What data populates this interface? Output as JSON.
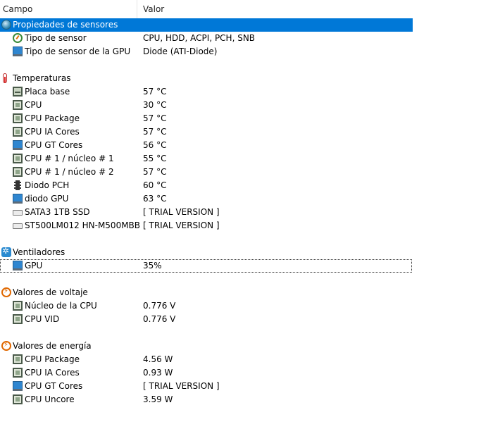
{
  "columns": {
    "campo": "Campo",
    "valor": "Valor"
  },
  "sections": [
    {
      "title": "Propiedades de sensores",
      "icon": "sensor-properties-icon",
      "selected": true,
      "items": [
        {
          "label": "Tipo de sensor",
          "value": "CPU, HDD, ACPI, PCH, SNB",
          "icon": "sensor-icon"
        },
        {
          "label": "Tipo de sensor de la GPU",
          "value": "Diode  (ATI-Diode)",
          "icon": "monitor-icon"
        }
      ]
    },
    {
      "title": "Temperaturas",
      "icon": "thermometer-icon",
      "items": [
        {
          "label": "Placa base",
          "value": "57 °C",
          "icon": "motherboard-icon"
        },
        {
          "label": "CPU",
          "value": "30 °C",
          "icon": "cpu-icon"
        },
        {
          "label": "CPU Package",
          "value": "57 °C",
          "icon": "cpu-icon"
        },
        {
          "label": "CPU IA Cores",
          "value": "57 °C",
          "icon": "cpu-icon"
        },
        {
          "label": "CPU GT Cores",
          "value": "56 °C",
          "icon": "monitor-icon"
        },
        {
          "label": "CPU # 1 / núcleo # 1",
          "value": "55 °C",
          "icon": "cpu-icon"
        },
        {
          "label": "CPU # 1 / núcleo # 2",
          "value": "57 °C",
          "icon": "cpu-icon"
        },
        {
          "label": "Diodo PCH",
          "value": "60 °C",
          "icon": "pch-chip-icon"
        },
        {
          "label": "diodo GPU",
          "value": "63 °C",
          "icon": "monitor-icon"
        },
        {
          "label": "SATA3 1TB SSD",
          "value": "[ TRIAL VERSION ]",
          "icon": "disk-icon"
        },
        {
          "label": "ST500LM012 HN-M500MBB",
          "value": "[ TRIAL VERSION ]",
          "icon": "disk-icon"
        }
      ]
    },
    {
      "title": "Ventiladores",
      "icon": "fan-icon",
      "items": [
        {
          "label": "GPU",
          "value": "35%",
          "icon": "monitor-icon",
          "focused": true
        }
      ]
    },
    {
      "title": "Valores de voltaje",
      "icon": "voltage-icon",
      "items": [
        {
          "label": "Núcleo de la CPU",
          "value": "0.776 V",
          "icon": "cpu-icon"
        },
        {
          "label": "CPU VID",
          "value": "0.776 V",
          "icon": "cpu-icon"
        }
      ]
    },
    {
      "title": "Valores de energía",
      "icon": "power-icon",
      "items": [
        {
          "label": "CPU Package",
          "value": "4.56 W",
          "icon": "cpu-icon"
        },
        {
          "label": "CPU IA Cores",
          "value": "0.93 W",
          "icon": "cpu-icon"
        },
        {
          "label": "CPU GT Cores",
          "value": "[ TRIAL VERSION ]",
          "icon": "monitor-icon"
        },
        {
          "label": "CPU Uncore",
          "value": "3.59 W",
          "icon": "cpu-icon"
        }
      ]
    }
  ]
}
